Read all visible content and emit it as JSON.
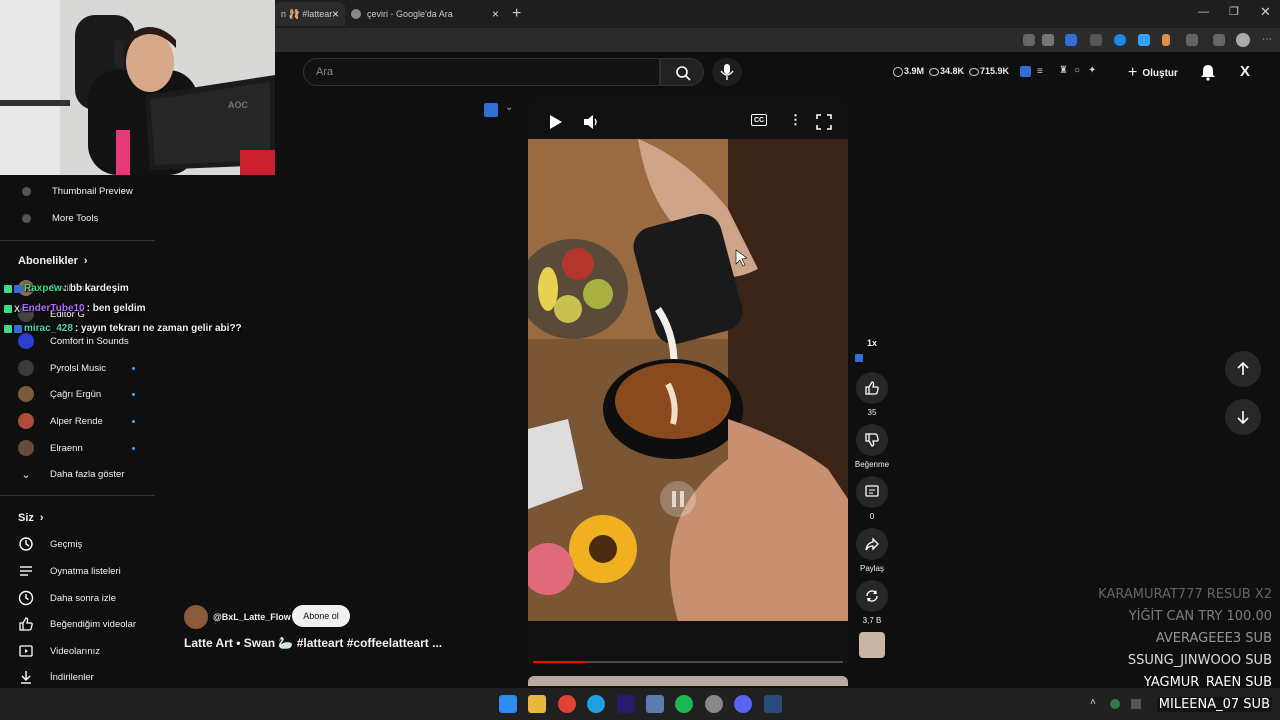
{
  "browser": {
    "tabs": [
      {
        "label": "n 🩰 #latteart",
        "active": true
      },
      {
        "label": "çeviri - Google'da Ara",
        "active": false
      }
    ]
  },
  "header": {
    "search_placeholder": "Ara",
    "stats": {
      "views": "3.9M",
      "watching": "34.8K",
      "subs": "715.9K"
    },
    "create_label": "Oluştur"
  },
  "sidebar": {
    "tools": [
      {
        "label": "Thumbnail Preview"
      },
      {
        "label": "More Tools"
      }
    ],
    "subscriptions_header": "Abonelikler",
    "subscriptions": [
      {
        "label": "Sevil Eski",
        "dot": false
      },
      {
        "label": "Editör G",
        "dot": false
      },
      {
        "label": "Comfort in Sounds",
        "dot": false
      },
      {
        "label": "Pyrolsl Music",
        "dot": true
      },
      {
        "label": "Çağrı Ergün",
        "dot": true
      },
      {
        "label": "Alper Rende",
        "dot": true
      },
      {
        "label": "Elraenn",
        "dot": true
      },
      {
        "label": "Daha fazla göster",
        "dot": false
      }
    ],
    "you_header": "Siz",
    "you_items": [
      {
        "label": "Geçmiş",
        "icon": "history-icon"
      },
      {
        "label": "Oynatma listeleri",
        "icon": "playlist-icon"
      },
      {
        "label": "Daha sonra izle",
        "icon": "clock-icon"
      },
      {
        "label": "Beğendiğim videolar",
        "icon": "thumbs-up-icon"
      },
      {
        "label": "Videolarınız",
        "icon": "video-icon"
      },
      {
        "label": "İndirilenler",
        "icon": "download-icon"
      }
    ]
  },
  "chat": [
    {
      "user": "Raxpew",
      "msg": ": bb kardeşim",
      "color": "#3ddc84"
    },
    {
      "user": "EnderTube10",
      "msg": ": ben geldim",
      "color": "#b06cff"
    },
    {
      "user": "mirac_428",
      "msg": ": yayın tekrarı ne zaman gelir abi??",
      "color": "#4fd6a8"
    }
  ],
  "video": {
    "progress": 0.17,
    "channel": "@BxL_Latte_Flow",
    "subscribe_label": "Abone ol",
    "title": "Latte Art • Swan 🦢 #latteart #coffeelatteart ..."
  },
  "actions": {
    "speed": "1x",
    "likes": "35",
    "dislike_label": "Beğenme",
    "comments": "0",
    "share_label": "Paylaş",
    "remix": "3,7 B"
  },
  "sub_alerts": [
    {
      "text": "KARAMURAT777  RESUB X2",
      "opacity": 0.35
    },
    {
      "text": "YİĞİT CAN  TRY 100.00",
      "opacity": 0.45
    },
    {
      "text": "AVERAGEEE3  SUB",
      "opacity": 0.55
    },
    {
      "text": "SSUNG_JINWOOO  SUB",
      "opacity": 0.85
    },
    {
      "text": "YAGMUR_RAEN  SUB",
      "opacity": 1
    },
    {
      "text": "MILEENA_07  SUB",
      "opacity": 1
    }
  ]
}
